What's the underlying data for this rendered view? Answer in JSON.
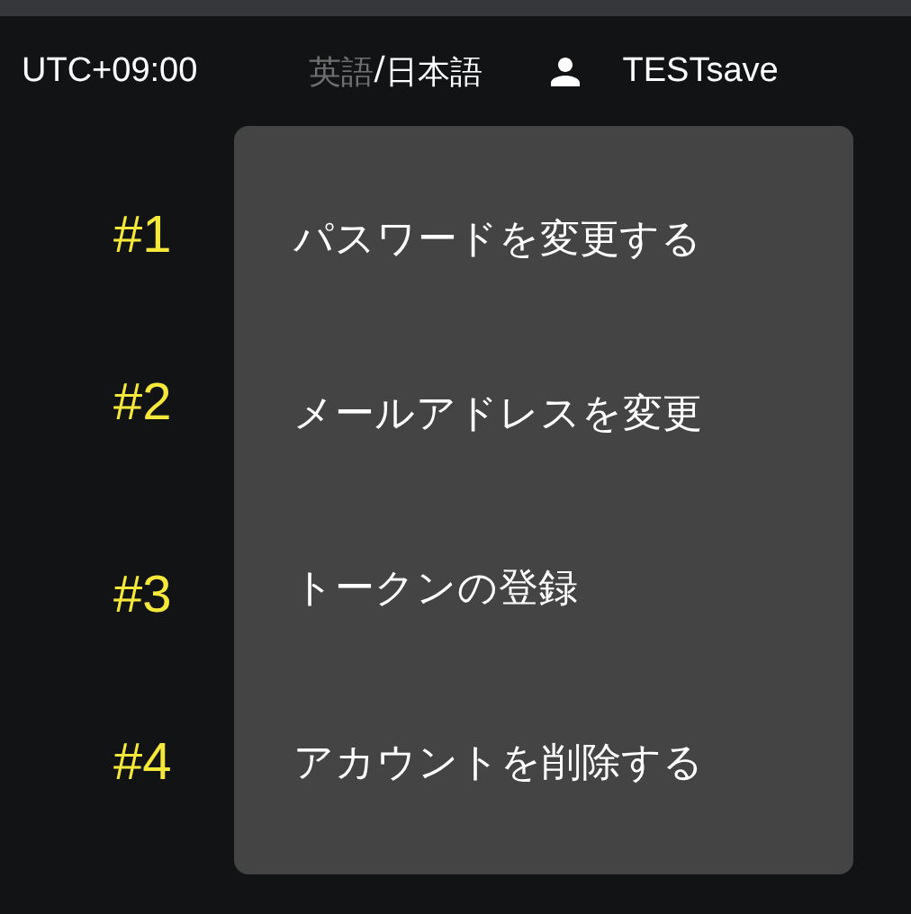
{
  "header": {
    "timezone": "UTC+09:00",
    "languages": [
      {
        "label": "英語",
        "selected": false
      },
      {
        "label": "日本語",
        "selected": true
      }
    ],
    "separator": "/",
    "user": "TESTsave"
  },
  "account_menu": {
    "items": [
      {
        "label": "パスワードを変更する",
        "marker": "#1"
      },
      {
        "label": "メールアドレスを変更",
        "marker": "#2"
      },
      {
        "label": "トークンの登録",
        "marker": "#3"
      },
      {
        "label": "アカウントを削除する",
        "marker": "#4"
      }
    ]
  }
}
